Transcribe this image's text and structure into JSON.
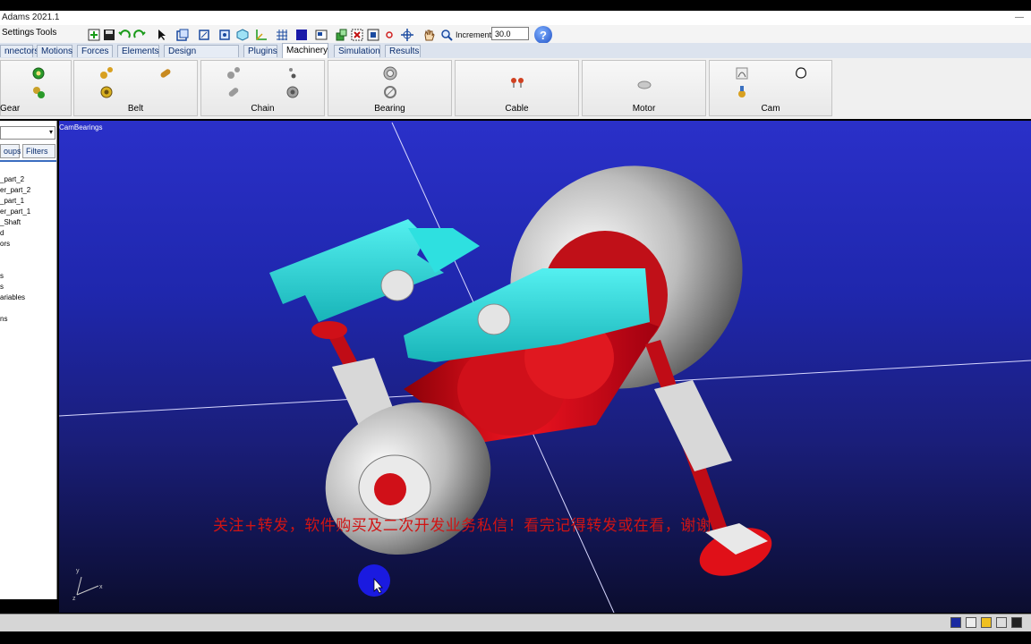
{
  "window": {
    "title": "Adams 2021.1"
  },
  "menu": [
    {
      "label": "Settings"
    },
    {
      "label": "Tools"
    }
  ],
  "toolbar": {
    "increment_label": "Increment",
    "increment_value": "30.0",
    "help_label": "?"
  },
  "tabs": [
    {
      "label": "nnectors"
    },
    {
      "label": "Motions"
    },
    {
      "label": "Forces"
    },
    {
      "label": "Elements"
    },
    {
      "label": "Design Exploration"
    },
    {
      "label": "Plugins"
    },
    {
      "label": "Machinery",
      "active": true
    },
    {
      "label": "Simulation"
    },
    {
      "label": "Results"
    }
  ],
  "ribbon_groups": [
    {
      "label": "Gear"
    },
    {
      "label": "Belt"
    },
    {
      "label": "Chain"
    },
    {
      "label": "Bearing"
    },
    {
      "label": "Cable"
    },
    {
      "label": "Motor"
    },
    {
      "label": "Cam"
    }
  ],
  "left_panel": {
    "buttons": [
      {
        "label": "oups"
      },
      {
        "label": "Filters"
      }
    ],
    "tree": [
      "_part_2",
      "er_part_2",
      "_part_1",
      "er_part_1",
      "_Shaft",
      "d",
      "ors",
      "s",
      "s",
      "ariables",
      "ns"
    ]
  },
  "viewport": {
    "model_name": "CamBearings",
    "triad_labels": {
      "y": "y",
      "x": "x",
      "z": "z"
    },
    "watermark": "关注+转发，软件购买及二次开发业务私信！看完记得转发或在看，谢谢"
  },
  "colors": {
    "cyan_part": "#2fd6d6",
    "red_part": "#d8101a",
    "grey_bearing": "#c8c8c8",
    "bg_top": "#2a30c9",
    "bg_bottom": "#0b0d2e",
    "watermark": "#d01414"
  }
}
